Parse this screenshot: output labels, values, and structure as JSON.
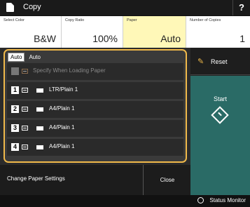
{
  "header": {
    "title": "Copy",
    "help": "?"
  },
  "settings": [
    {
      "label": "Select Color",
      "value": "B&W"
    },
    {
      "label": "Copy Ratio",
      "value": "100%"
    },
    {
      "label": "Paper",
      "value": "Auto"
    },
    {
      "label": "Number of Copies",
      "value": "1"
    }
  ],
  "popup": {
    "auto_chip": "Auto",
    "auto_text": "Auto",
    "rows": [
      {
        "num": "",
        "label": "Specify When Loading Paper",
        "disabled": true
      },
      {
        "num": "1",
        "label": "LTR/Plain 1"
      },
      {
        "num": "2",
        "label": "A4/Plain 1"
      },
      {
        "num": "3",
        "label": "A4/Plain 1"
      },
      {
        "num": "4",
        "label": "A4/Plain 1"
      }
    ]
  },
  "right": {
    "reset": "Reset",
    "start": "Start"
  },
  "bottom": {
    "change": "Change Paper Settings",
    "close": "Close"
  },
  "status": {
    "monitor": "Status Monitor"
  }
}
